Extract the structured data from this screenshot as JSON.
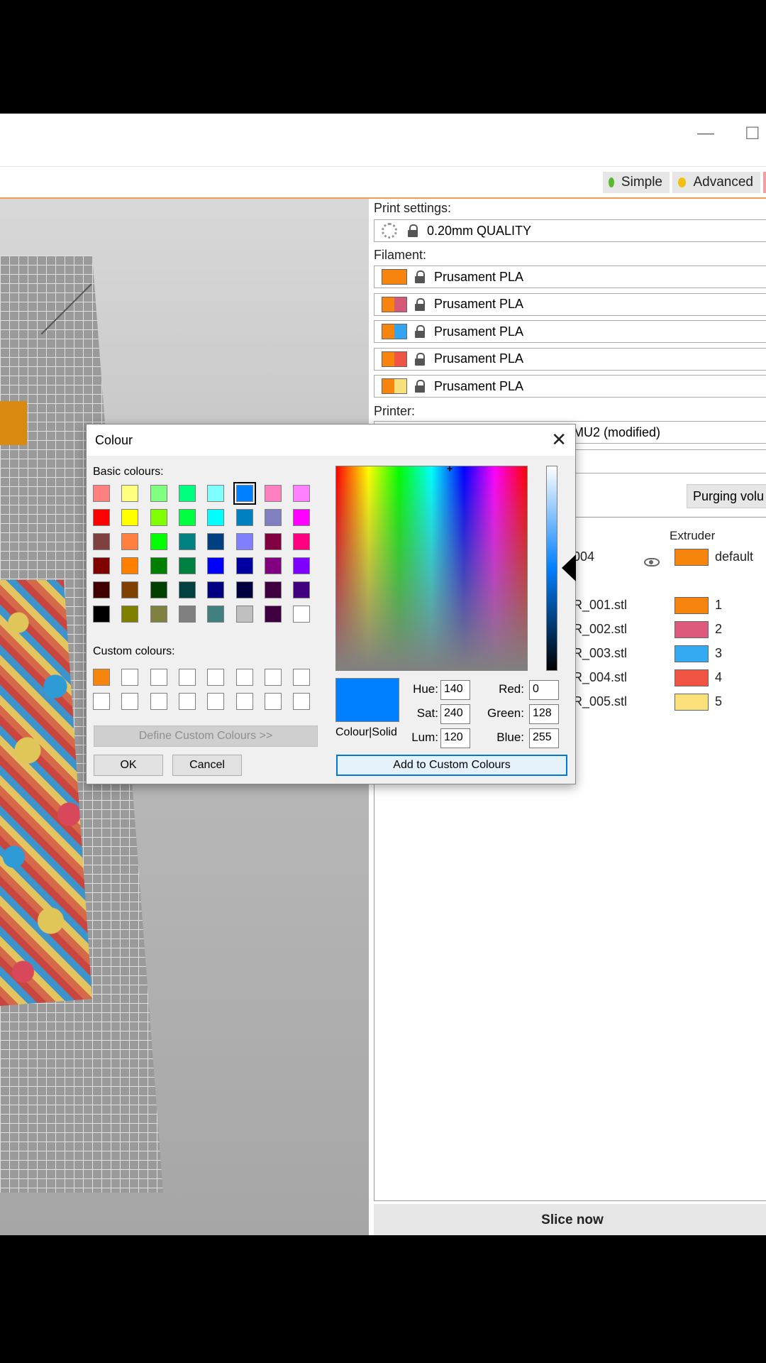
{
  "window": {
    "minimize_glyph": "—",
    "maximize_glyph": "☐"
  },
  "modes": {
    "simple": "Simple",
    "advanced": "Advanced",
    "simple_color": "#5bb82e",
    "advanced_color": "#f2c010"
  },
  "print_settings": {
    "label": "Print settings:",
    "value": "0.20mm QUALITY"
  },
  "filament": {
    "label": "Filament:",
    "items": [
      {
        "name": "Prusament PLA",
        "colors": [
          "#f7840c",
          "#f7840c"
        ]
      },
      {
        "name": "Prusament PLA",
        "colors": [
          "#f7840c",
          "#d65a78"
        ]
      },
      {
        "name": "Prusament PLA",
        "colors": [
          "#f7840c",
          "#33a4f0"
        ]
      },
      {
        "name": "Prusament PLA",
        "colors": [
          "#f7840c",
          "#f05444"
        ]
      },
      {
        "name": "Prusament PLA",
        "colors": [
          "#f7840c",
          "#f7e07a"
        ]
      }
    ]
  },
  "printer": {
    "label": "Printer:",
    "value": "MU2 (modified)"
  },
  "purging_button": "Purging volu",
  "object_list": {
    "extruder_header": "Extruder",
    "parent": {
      "name": "004",
      "extruder": "default",
      "color": "#f7840c"
    },
    "parts": [
      {
        "name": "R_001.stl",
        "extruder": "1",
        "color": "#f7840c"
      },
      {
        "name": "R_002.stl",
        "extruder": "2",
        "color": "#de5a7c"
      },
      {
        "name": "R_003.stl",
        "extruder": "3",
        "color": "#33aaf2"
      },
      {
        "name": "R_004.stl",
        "extruder": "4",
        "color": "#f25444"
      },
      {
        "name": "R_005.stl",
        "extruder": "5",
        "color": "#f9e07a"
      }
    ]
  },
  "slice_button": "Slice now",
  "colour_dialog": {
    "title": "Colour",
    "close_glyph": "✕",
    "basic_label": "Basic colours:",
    "basic_colours": [
      [
        "#ff8080",
        "#ffff80",
        "#80ff80",
        "#00ff80",
        "#80ffff",
        "#0080ff",
        "#ff80c0",
        "#ff80ff"
      ],
      [
        "#ff0000",
        "#ffff00",
        "#80ff00",
        "#00ff40",
        "#00ffff",
        "#0080c0",
        "#8080c0",
        "#ff00ff"
      ],
      [
        "#804040",
        "#ff8040",
        "#00ff00",
        "#008080",
        "#004080",
        "#8080ff",
        "#800040",
        "#ff0080"
      ],
      [
        "#800000",
        "#ff8000",
        "#008000",
        "#008040",
        "#0000ff",
        "#0000a0",
        "#800080",
        "#8000ff"
      ],
      [
        "#400000",
        "#804000",
        "#004000",
        "#004040",
        "#000080",
        "#000040",
        "#400040",
        "#400080"
      ],
      [
        "#000000",
        "#808000",
        "#808040",
        "#808080",
        "#408080",
        "#c0c0c0",
        "#400040",
        "#ffffff"
      ]
    ],
    "selected_basic": "#0080ff",
    "custom_label": "Custom colours:",
    "custom_colours": [
      [
        "#f7840c",
        "#ffffff",
        "#ffffff",
        "#ffffff",
        "#ffffff",
        "#ffffff",
        "#ffffff",
        "#ffffff"
      ],
      [
        "#ffffff",
        "#ffffff",
        "#ffffff",
        "#ffffff",
        "#ffffff",
        "#ffffff",
        "#ffffff",
        "#ffffff"
      ]
    ],
    "define_custom": "Define Custom Colours >>",
    "ok": "OK",
    "cancel": "Cancel",
    "preview_color": "#0080ff",
    "colour_solid": "Colour|Solid",
    "hue_label": "Hue:",
    "hue": "140",
    "sat_label": "Sat:",
    "sat": "240",
    "lum_label": "Lum:",
    "lum": "120",
    "red_label": "Red:",
    "red": "0",
    "green_label": "Green:",
    "green": "128",
    "blue_label": "Blue:",
    "blue": "255",
    "add_custom": "Add to Custom Colours"
  }
}
